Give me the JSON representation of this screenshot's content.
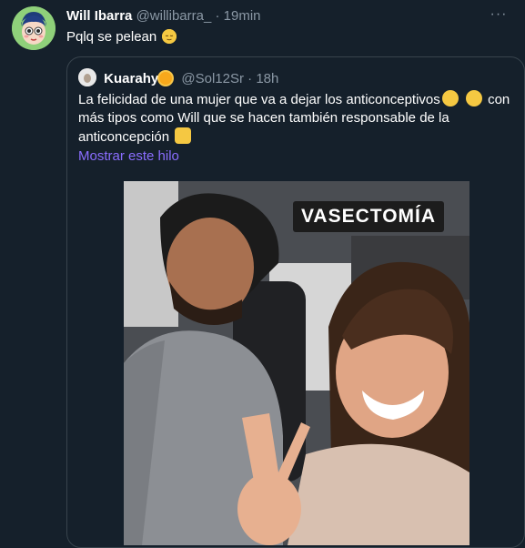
{
  "tweet": {
    "author_name": "Will Ibarra",
    "author_handle": "@willibarra_",
    "time": "19min",
    "text": "Pqlq se pelean",
    "text_emoji": "relieved-face-emoji"
  },
  "quote": {
    "author_name": "Kuarahy",
    "name_emoji": "sun-emoji",
    "author_handle": "@Sol12Sr",
    "time": "18h",
    "line1": "La felicidad de una mujer que va a dejar los anticonceptivos",
    "line1_tail": "con",
    "line2": "más tipos como Will que se hacen también responsable de la",
    "line3": "anticoncepción",
    "emojis": [
      "partying-face-emoji",
      "star-struck-emoji",
      "raising-hands-emoji"
    ],
    "show_thread": "Mostrar este hilo",
    "image_label": "VASECTOMÍA"
  },
  "colors": {
    "background": "#15202b",
    "secondary_text": "#8b98a5",
    "border": "#38444d",
    "link": "#8a6dff"
  }
}
